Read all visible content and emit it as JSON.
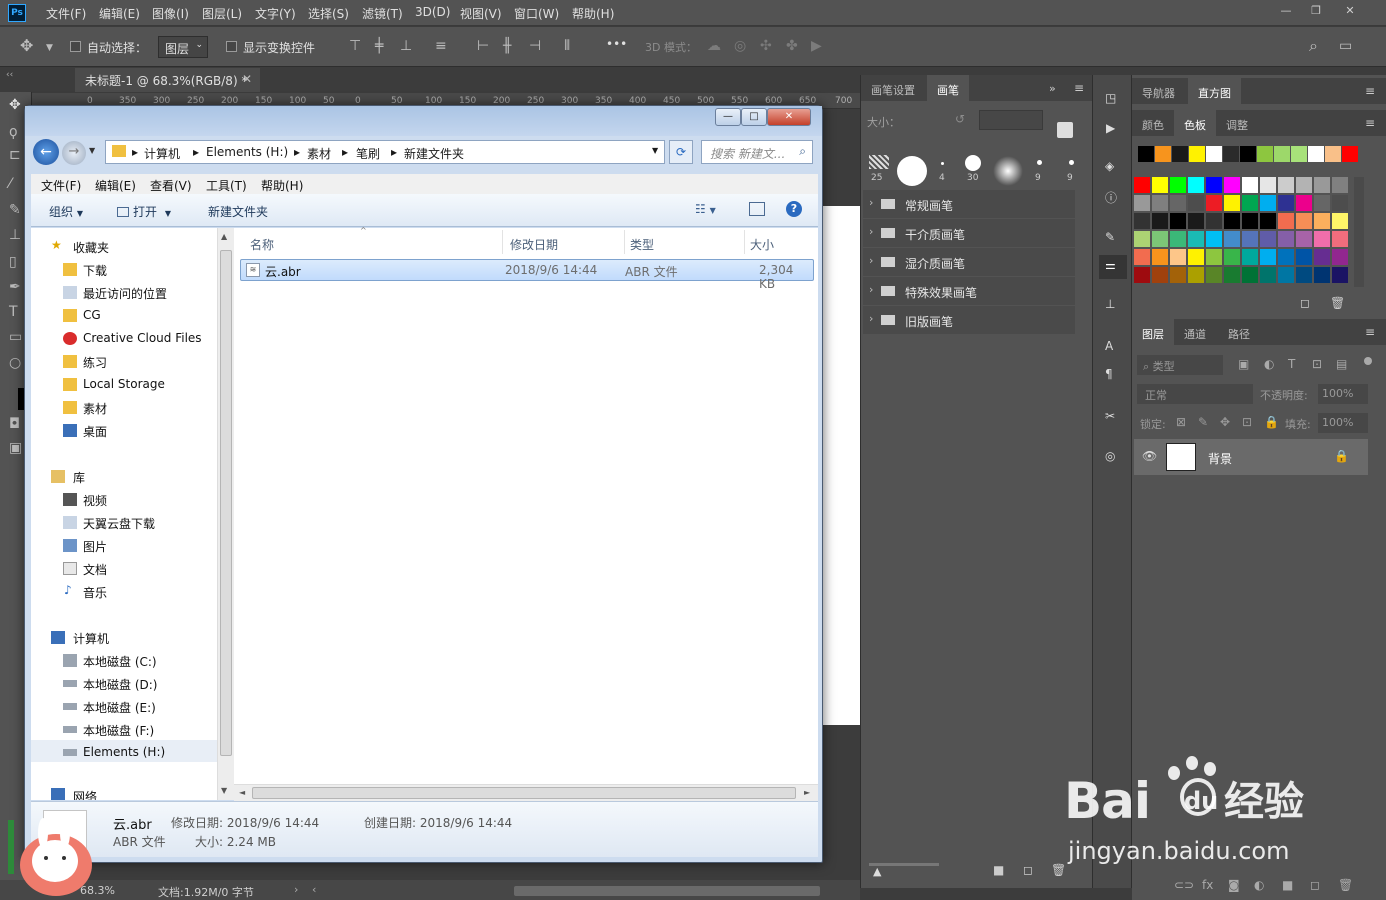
{
  "ps": {
    "logo": "Ps",
    "menu": [
      "文件(F)",
      "编辑(E)",
      "图像(I)",
      "图层(L)",
      "文字(Y)",
      "选择(S)",
      "滤镜(T)",
      "3D(D)",
      "视图(V)",
      "窗口(W)",
      "帮助(H)"
    ],
    "options": {
      "auto_select": "自动选择：",
      "layer_select": "图层",
      "show_transform": "显示变换控件",
      "more": "•••",
      "mode_3d": "3D 模式："
    },
    "doc_tab": "未标题-1 @ 68.3%(RGB/8) *",
    "ruler_ticks": [
      "0",
      "350",
      "300",
      "250",
      "200",
      "150",
      "100",
      "50",
      "0",
      "50",
      "100",
      "150",
      "200",
      "250",
      "300",
      "350",
      "400",
      "450",
      "500",
      "550",
      "600",
      "650",
      "700"
    ],
    "status": {
      "zoom": "68.3%",
      "doc": "文档:1.92M/0 字节"
    }
  },
  "brush_panel": {
    "tabs": [
      "画笔设置",
      "画笔"
    ],
    "size_label": "大小：",
    "brush_sizes": [
      "25",
      "",
      "4",
      "30",
      "",
      "9",
      "9"
    ],
    "folders": [
      "常规画笔",
      "干介质画笔",
      "湿介质画笔",
      "特殊效果画笔",
      "旧版画笔"
    ]
  },
  "right_panel": {
    "top_tabs": [
      "导航器",
      "直方图"
    ],
    "color_tabs": [
      "颜色",
      "色板",
      "调整"
    ],
    "layer_tabs": [
      "图层",
      "通道",
      "路径"
    ],
    "filter_placeholder": "类型",
    "blend_mode": "正常",
    "opacity_label": "不透明度:",
    "opacity_value": "100%",
    "lock_label": "锁定:",
    "fill_label": "填充:",
    "fill_value": "100%",
    "layer_name": "背景",
    "swatch_row0": [
      "#000000",
      "#f7941d",
      "#1a1a1a",
      "#fff200",
      "#ffffff",
      "#2b2b2b",
      "#000000",
      "#8dc63f",
      "#9dd86a",
      "#a8e27a",
      "#ffffff",
      "#f9c089",
      "#ff0000"
    ],
    "swatches": [
      [
        "#ff0000",
        "#ffff00",
        "#00ff00",
        "#00ffff",
        "#0000ff",
        "#ff00ff",
        "#ffffff",
        "#e6e6e6",
        "#cccccc",
        "#b3b3b3",
        "#999999",
        "#808080"
      ],
      [
        "#999999",
        "#7f7f7f",
        "#666666",
        "#4d4d4d",
        "#ed1c24",
        "#fff200",
        "#00a651",
        "#00aeef",
        "#2e3192",
        "#ec008c",
        "#666666",
        "#4d4d4d"
      ],
      [
        "#333333",
        "#1a1a1a",
        "#000000",
        "#1a1a1a",
        "#333333",
        "#000000",
        "#000000",
        "#000000",
        "#f26c4f",
        "#f68e56",
        "#fbaf5d",
        "#fff568"
      ],
      [
        "#acd373",
        "#7cc576",
        "#3bb878",
        "#1abbb4",
        "#00bff3",
        "#438ccb",
        "#5574b9",
        "#605ca8",
        "#855fa8",
        "#a763a8",
        "#f06eaa",
        "#f26d7d"
      ],
      [
        "#f26c4f",
        "#f7941d",
        "#fdc689",
        "#fff200",
        "#8dc63f",
        "#39b54a",
        "#00a99d",
        "#00aeef",
        "#0072bc",
        "#0054a6",
        "#662d91",
        "#92278f"
      ],
      [
        "#9e0b0f",
        "#a0410d",
        "#a36209",
        "#aba000",
        "#598527",
        "#197b30",
        "#007236",
        "#00746b",
        "#0076a3",
        "#004a80",
        "#003471",
        "#1b1464"
      ]
    ]
  },
  "explorer": {
    "window_buttons": [
      "—",
      "□",
      "✕"
    ],
    "breadcrumb": [
      "计算机",
      "Elements (H:)",
      "素材",
      "笔刷",
      "新建文件夹"
    ],
    "search_placeholder": "搜索 新建文...",
    "menu": [
      "文件(F)",
      "编辑(E)",
      "查看(V)",
      "工具(T)",
      "帮助(H)"
    ],
    "commands": {
      "organize": "组织",
      "open": "打开",
      "new_folder": "新建文件夹"
    },
    "nav": {
      "favorites_header": "收藏夹",
      "favorites": [
        "下载",
        "最近访问的位置",
        "CG",
        "Creative Cloud Files",
        "练习",
        "Local Storage",
        "素材",
        "桌面"
      ],
      "library_header": "库",
      "libraries": [
        "视频",
        "天翼云盘下载",
        "图片",
        "文档",
        "音乐"
      ],
      "computer_header": "计算机",
      "drives": [
        "本地磁盘 (C:)",
        "本地磁盘 (D:)",
        "本地磁盘 (E:)",
        "本地磁盘 (F:)",
        "Elements (H:)"
      ],
      "network_header": "网络"
    },
    "columns": [
      "名称",
      "修改日期",
      "类型",
      "大小"
    ],
    "file": {
      "name": "云.abr",
      "modified": "2018/9/6 14:44",
      "type": "ABR 文件",
      "size": "2,304 KB"
    },
    "details": {
      "name": "云.abr",
      "modified_label": "修改日期: 2018/9/6 14:44",
      "created_label": "创建日期: 2018/9/6 14:44",
      "type": "ABR 文件",
      "size_label": "大小: 2.24 MB"
    }
  },
  "watermark": {
    "logo": "Bai",
    "logo_paw": "du",
    "brand": "经验",
    "url": "jingyan.baidu.com"
  }
}
